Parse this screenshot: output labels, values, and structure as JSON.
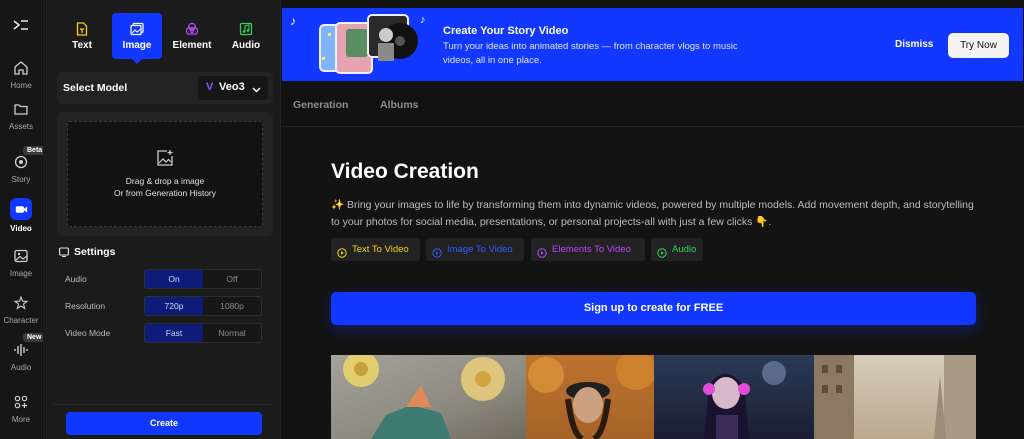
{
  "rail": {
    "items": [
      {
        "label": "Home",
        "icon": "home-icon"
      },
      {
        "label": "Assets",
        "icon": "folder-icon"
      },
      {
        "label": "Story",
        "icon": "story-icon",
        "badge": "Beta"
      },
      {
        "label": "Video",
        "icon": "video-camera-icon",
        "active": true
      },
      {
        "label": "Image",
        "icon": "image-icon"
      },
      {
        "label": "Character",
        "icon": "character-icon"
      },
      {
        "label": "Audio",
        "icon": "audio-waveform-icon",
        "badge": "New"
      },
      {
        "label": "More",
        "icon": "grid-plus-icon"
      }
    ]
  },
  "panel": {
    "tabs": [
      {
        "label": "Text",
        "icon": "text-file-icon",
        "color": "#f5d31b"
      },
      {
        "label": "Image",
        "icon": "image-icon",
        "color": "#ffffff",
        "active": true
      },
      {
        "label": "Element",
        "icon": "element-circles-icon",
        "color": "#b44bff"
      },
      {
        "label": "Audio",
        "icon": "audio-file-icon",
        "color": "#35d35a"
      }
    ],
    "select_model_label": "Select Model",
    "model_value": "Veo3",
    "upload": {
      "line1": "Drag & drop a image",
      "line2": "Or from Generation History"
    },
    "settings_title": "Settings",
    "settings": [
      {
        "label": "Audio",
        "options": [
          "On",
          "Off"
        ],
        "selected": 0
      },
      {
        "label": "Resolution",
        "options": [
          "720p",
          "1080p"
        ],
        "selected": 0
      },
      {
        "label": "Video Mode",
        "options": [
          "Fast",
          "Normal"
        ],
        "selected": 0
      }
    ],
    "create_label": "Create"
  },
  "banner": {
    "title": "Create Your Story Video",
    "subtitle": "Turn your ideas into animated stories — from character vlogs to music videos, all in one place.",
    "dismiss_label": "Dismiss",
    "try_label": "Try Now"
  },
  "main_tabs": [
    "Generation",
    "Albums"
  ],
  "main": {
    "title": "Video Creation",
    "description": "✨ Bring your images to life by transforming them into dynamic videos, powered by multiple models. Add movement depth, and storytelling to your photos for social media, presentations, or personal projects-all with just a few clicks 👇.",
    "chips": [
      {
        "label": "Text To Video",
        "color": "#f5d31b"
      },
      {
        "label": "Image To Video",
        "color": "#2f5cff"
      },
      {
        "label": "Elements To Video",
        "color": "#b44bff"
      },
      {
        "label": "Audio",
        "color": "#35d35a"
      }
    ],
    "signup_label": "Sign up to create for FREE"
  },
  "colors": {
    "accent": "#1238ff",
    "background": "#121212",
    "panel": "#1b1b1b"
  }
}
